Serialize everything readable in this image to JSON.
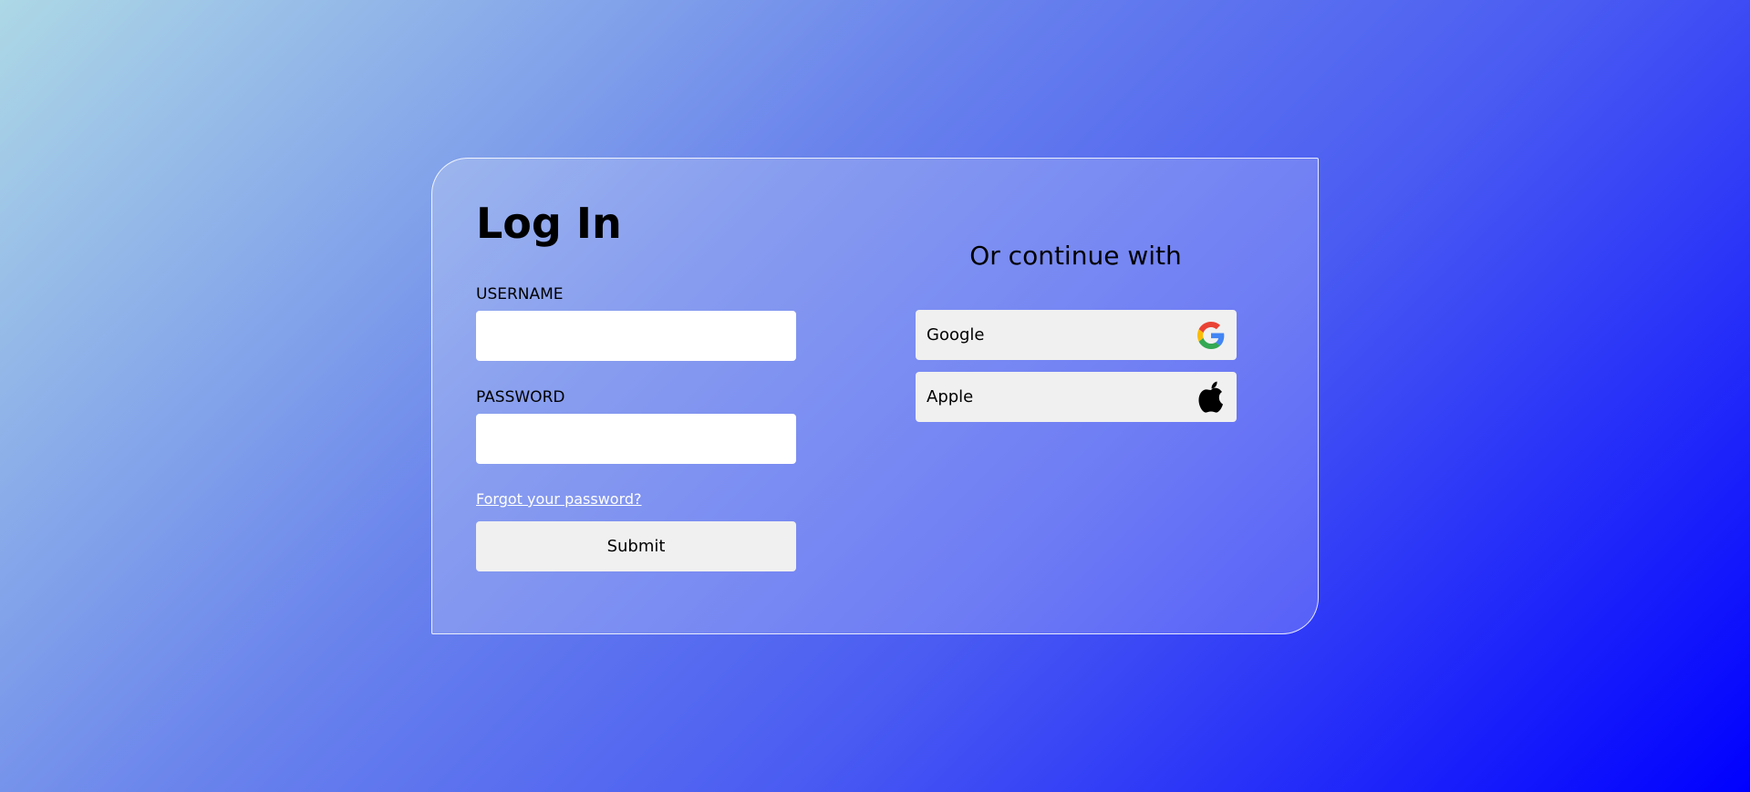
{
  "login": {
    "title": "Log In",
    "username_label": "USERNAME",
    "username_value": "",
    "password_label": "PASSWORD",
    "password_value": "",
    "forgot_link": "Forgot your password?",
    "submit_label": "Submit"
  },
  "social": {
    "heading": "Or continue with",
    "providers": [
      {
        "label": "Google",
        "icon": "google-icon"
      },
      {
        "label": "Apple",
        "icon": "apple-icon"
      }
    ]
  },
  "colors": {
    "gradient_start": "#add8e6",
    "gradient_end": "#0000ff",
    "button_bg": "#f0f0f0",
    "link": "#ffffff"
  }
}
